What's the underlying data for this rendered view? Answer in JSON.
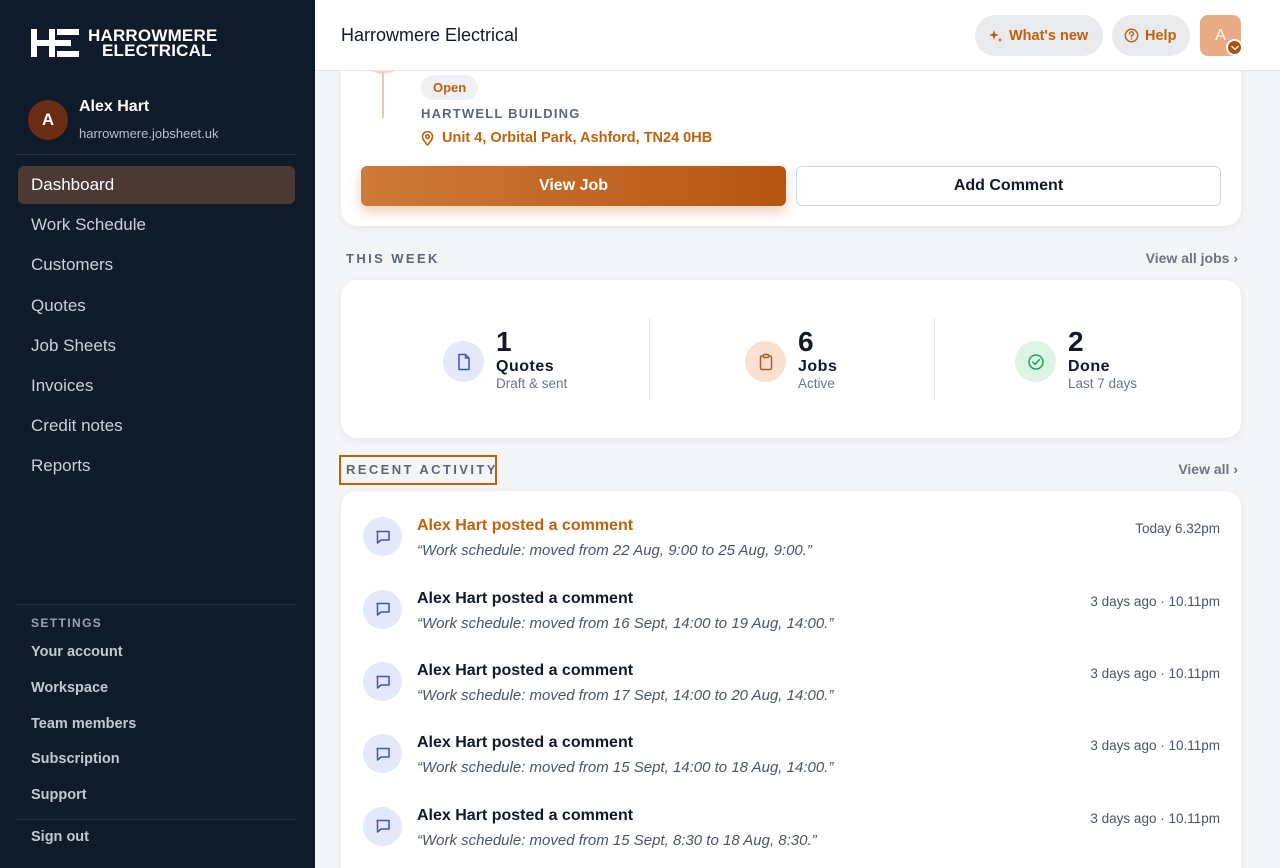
{
  "brand": {
    "logo_line1": "HARROWMERE",
    "logo_line2": "ELECTRICAL",
    "logo_mark": "HE",
    "accent_color": "#c2610c",
    "sidebar_color": "#0f1a2a"
  },
  "user": {
    "initial": "A",
    "name": "Alex Hart",
    "site": "harrowmere.jobsheet.uk"
  },
  "nav": {
    "items": [
      {
        "label": "Dashboard",
        "active": true
      },
      {
        "label": "Work Schedule"
      },
      {
        "label": "Customers"
      },
      {
        "label": "Quotes"
      },
      {
        "label": "Job Sheets"
      },
      {
        "label": "Invoices"
      },
      {
        "label": "Credit notes"
      },
      {
        "label": "Reports"
      }
    ]
  },
  "settings": {
    "title": "SETTINGS",
    "items": [
      "Your account",
      "Workspace",
      "Team members",
      "Subscription",
      "Support"
    ],
    "sign_out": "Sign out"
  },
  "topbar": {
    "title": "Harrowmere Electrical",
    "whats_new": "What's new",
    "help": "Help",
    "avatar_initial": "A"
  },
  "job": {
    "status": "Open",
    "building": "HARTWELL BUILDING",
    "address": "Unit 4, Orbital Park, Ashford, TN24 0HB",
    "view_button": "View Job",
    "comment_button": "Add Comment"
  },
  "week": {
    "label": "THIS WEEK",
    "link": "View all jobs ›",
    "stats": [
      {
        "value": "1",
        "label": "Quotes",
        "sub": "Draft & sent",
        "icon": "document-icon"
      },
      {
        "value": "6",
        "label": "Jobs",
        "sub": "Active",
        "icon": "clipboard-icon"
      },
      {
        "value": "2",
        "label": "Done",
        "sub": "Last 7 days",
        "icon": "check-circle-icon"
      }
    ]
  },
  "activity": {
    "label": "RECENT ACTIVITY",
    "link": "View all ›",
    "items": [
      {
        "title": "Alex Hart posted a comment",
        "text": "“Work schedule: moved from 22 Aug, 9:00 to 25 Aug, 9:00.”",
        "time": "Today 6.32pm"
      },
      {
        "title": "Alex Hart posted a comment",
        "text": "“Work schedule: moved from 16 Sept, 14:00 to 19 Aug, 14:00.”",
        "time": "3 days ago · 10.11pm"
      },
      {
        "title": "Alex Hart posted a comment",
        "text": "“Work schedule: moved from 17 Sept, 14:00 to 20 Aug, 14:00.”",
        "time": "3 days ago · 10.11pm"
      },
      {
        "title": "Alex Hart posted a comment",
        "text": "“Work schedule: moved from 15 Sept, 14:00 to 18 Aug, 14:00.”",
        "time": "3 days ago · 10.11pm"
      },
      {
        "title": "Alex Hart posted a comment",
        "text": "“Work schedule: moved from 15 Sept, 8:30 to 18 Aug, 8:30.”",
        "time": "3 days ago · 10.11pm"
      }
    ]
  }
}
